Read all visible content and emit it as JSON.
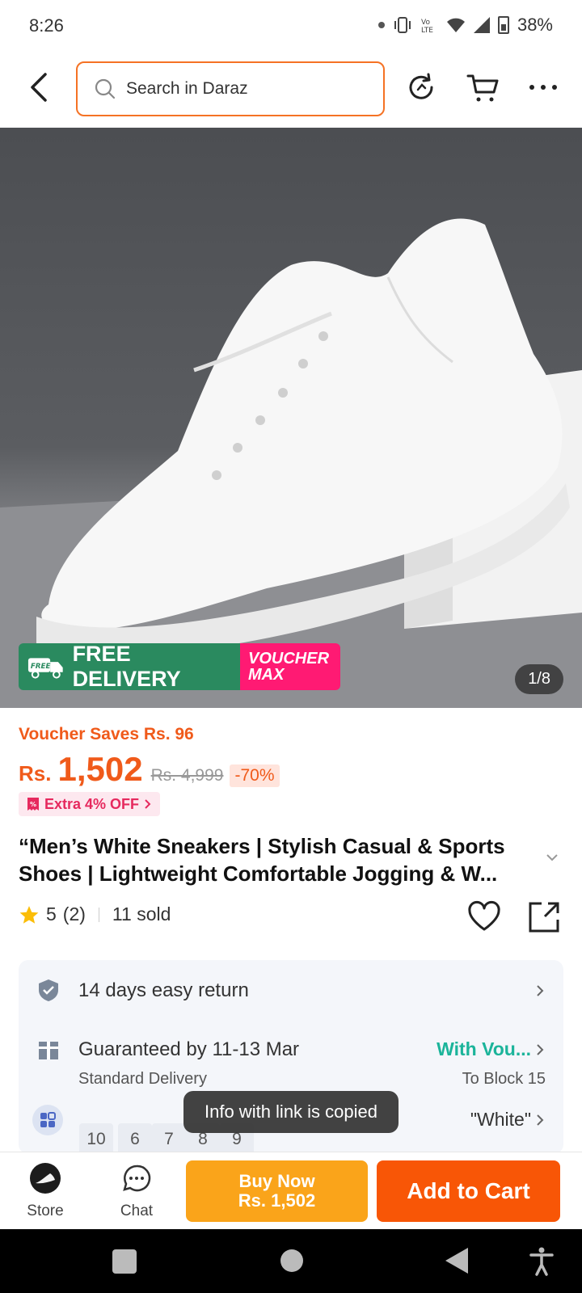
{
  "status": {
    "time": "8:26",
    "battery": "38%"
  },
  "header": {
    "search_placeholder": "Search in Daraz"
  },
  "gallery": {
    "promo_free_label": "FREE DELIVERY",
    "promo_free_badge": "FREE",
    "promo_voucher_top": "VOUCHER",
    "promo_voucher_bottom": "MAX",
    "counter": "1/8"
  },
  "pricing": {
    "voucher_saves": "Voucher Saves Rs. 96",
    "currency": "Rs.",
    "price": "1,502",
    "old_price": "Rs. 4,999",
    "discount": "-70%",
    "extra_off": "Extra 4% OFF"
  },
  "product": {
    "title": "“Men’s White Sneakers | Stylish Casual & Sports Shoes | Lightweight Comfortable Jogging & W...",
    "rating": "5",
    "rating_count": "(2)",
    "sold": "11 sold"
  },
  "services": {
    "returns": "14 days easy return",
    "guarantee": "Guaranteed by 11-13 Mar",
    "delivery_type": "Standard Delivery",
    "voucher_link": "With Vou...",
    "location": "To Block 15",
    "sizes": [
      "10",
      "6",
      "7",
      "8",
      "9"
    ],
    "selected_color": "\"White\""
  },
  "toast": {
    "message": "Info with link is copied"
  },
  "bottom_bar": {
    "store_label": "Store",
    "chat_label": "Chat",
    "buy_now_line1": "Buy Now",
    "buy_now_line2": "Rs. 1,502",
    "add_to_cart": "Add to Cart"
  },
  "colors": {
    "accent": "#f85606",
    "buy_now": "#faa41a",
    "price": "#f05a1a",
    "free_delivery": "#2a8a5f",
    "voucher_max": "#ff1a73",
    "link_green": "#1bb49a"
  }
}
